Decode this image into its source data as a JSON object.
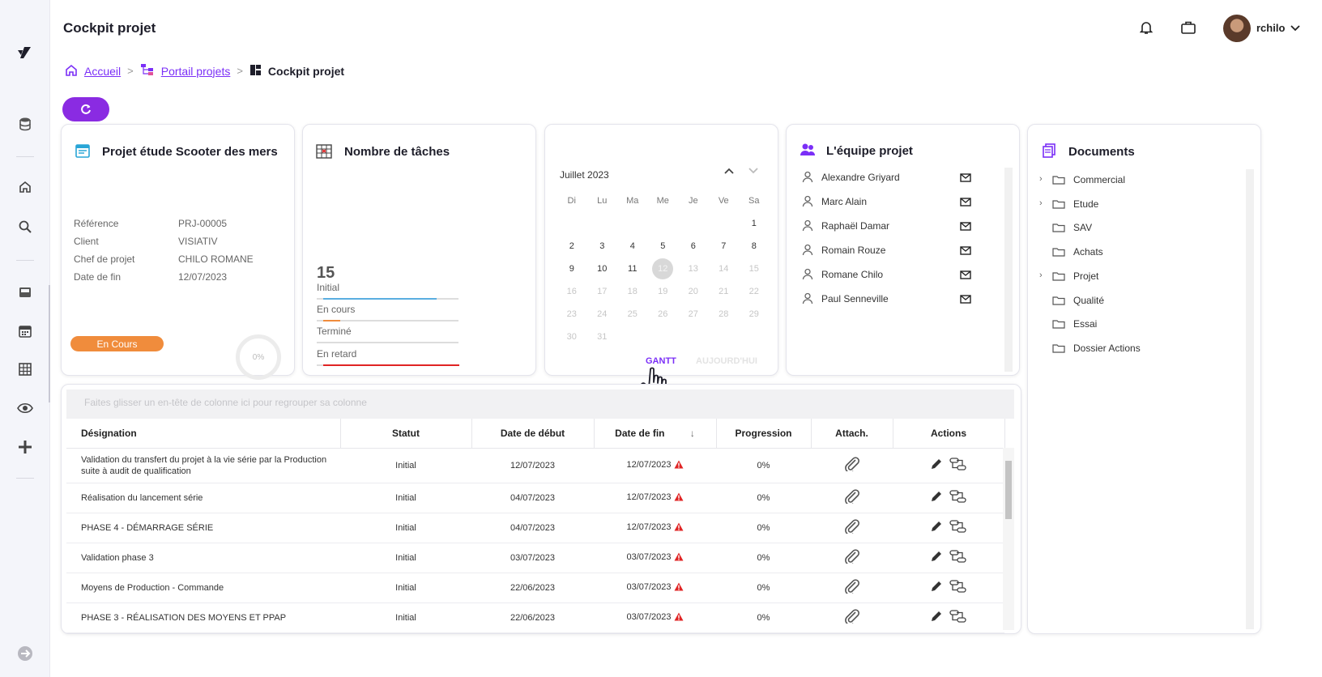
{
  "header": {
    "title": "Cockpit projet",
    "username": "rchilo"
  },
  "breadcrumb": {
    "home": "Accueil",
    "portal": "Portail projets",
    "current": "Cockpit projet"
  },
  "project": {
    "title": "Projet étude Scooter des mers",
    "fields": [
      {
        "label": "Référence",
        "value": "PRJ-00005"
      },
      {
        "label": "Client",
        "value": "VISIATIV"
      },
      {
        "label": "Chef de projet",
        "value": "CHILO ROMANE"
      },
      {
        "label": "Date de fin",
        "value": "12/07/2023"
      }
    ],
    "status": "En Cours",
    "progress": "0%"
  },
  "tasks": {
    "title": "Nombre de tâches",
    "total": "15",
    "rows": [
      {
        "label": "Initial",
        "fraction": 0.8,
        "color": "#5aaee0"
      },
      {
        "label": "En cours",
        "fraction": 0.12,
        "color": "#f08c3c"
      },
      {
        "label": "Terminé",
        "fraction": 0.0,
        "color": "#8c8c8c"
      },
      {
        "label": "En retard",
        "fraction": 0.96,
        "color": "#e02424"
      }
    ]
  },
  "calendar": {
    "month": "Juillet 2023",
    "weekdays": [
      "Di",
      "Lu",
      "Ma",
      "Me",
      "Je",
      "Ve",
      "Sa"
    ],
    "today": "12",
    "gantt_label": "GANTT",
    "today_label": "AUJOURD'HUI"
  },
  "team": {
    "title": "L'équipe projet",
    "members": [
      "Alexandre Griyard",
      "Marc Alain",
      "Raphaël Damar",
      "Romain Rouze",
      "Romane Chilo",
      "Paul Senneville"
    ]
  },
  "documents": {
    "title": "Documents",
    "folders": [
      {
        "name": "Commercial",
        "expandable": true
      },
      {
        "name": "Etude",
        "expandable": true
      },
      {
        "name": "SAV",
        "expandable": false
      },
      {
        "name": "Achats",
        "expandable": false
      },
      {
        "name": "Projet",
        "expandable": true
      },
      {
        "name": "Qualité",
        "expandable": false
      },
      {
        "name": "Essai",
        "expandable": false
      },
      {
        "name": "Dossier Actions",
        "expandable": false
      }
    ]
  },
  "grid": {
    "group_hint": "Faites glisser un en-tête de colonne ici pour regrouper sa colonne",
    "columns": [
      "Désignation",
      "Statut",
      "Date de début",
      "Date de fin",
      "Progression",
      "Attach.",
      "Actions"
    ],
    "rows": [
      {
        "designation": "Validation du transfert du projet à la vie série par la Production suite à audit de qualification",
        "statut": "Initial",
        "debut": "12/07/2023",
        "fin": "12/07/2023",
        "progression": "0%"
      },
      {
        "designation": "Réalisation du lancement série",
        "statut": "Initial",
        "debut": "04/07/2023",
        "fin": "12/07/2023",
        "progression": "0%"
      },
      {
        "designation": "PHASE 4 - DÉMARRAGE SÉRIE",
        "statut": "Initial",
        "debut": "04/07/2023",
        "fin": "12/07/2023",
        "progression": "0%"
      },
      {
        "designation": "Validation phase 3",
        "statut": "Initial",
        "debut": "03/07/2023",
        "fin": "03/07/2023",
        "progression": "0%"
      },
      {
        "designation": "Moyens de Production - Commande",
        "statut": "Initial",
        "debut": "22/06/2023",
        "fin": "03/07/2023",
        "progression": "0%"
      },
      {
        "designation": "PHASE 3 - RÉALISATION DES MOYENS ET PPAP",
        "statut": "Initial",
        "debut": "22/06/2023",
        "fin": "03/07/2023",
        "progression": "0%"
      }
    ]
  },
  "icons": {
    "accent": "#7b2ff7",
    "warning": "#e02424"
  }
}
